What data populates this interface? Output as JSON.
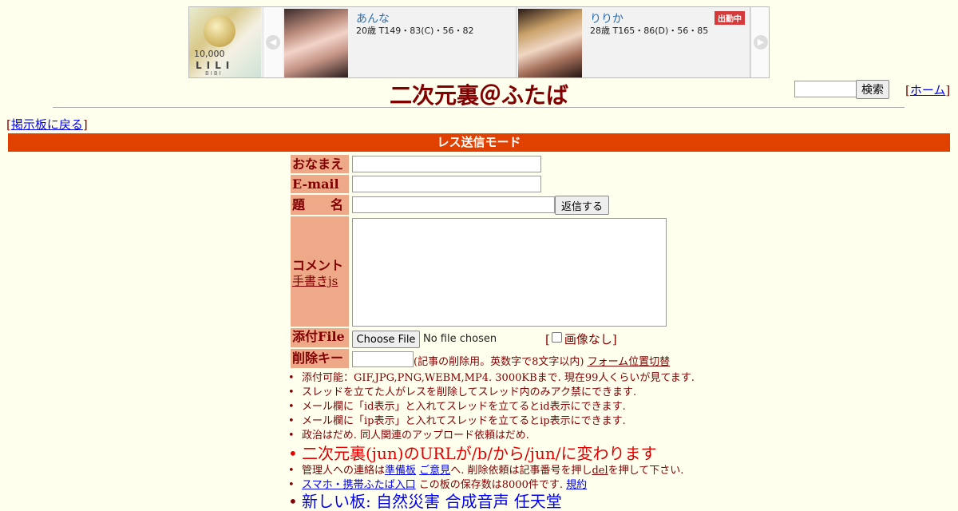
{
  "ad": {
    "logo_price": "10,000",
    "logo_brand": "LILI",
    "logo_brand_sub": "BIBI",
    "prev_glyph": "◀",
    "next_glyph": "▶",
    "cards": [
      {
        "name": "あんな",
        "stats": "20歳 T149・83(C)・56・82",
        "badge": ""
      },
      {
        "name": "りりか",
        "stats": "28歳 T165・86(D)・56・85",
        "badge": "出勤中"
      }
    ]
  },
  "header": {
    "title": "二次元裏＠ふたば",
    "search_button": "検索",
    "home_link": "ホーム",
    "back_link": "掲示板に戻る"
  },
  "mode_bar": "レス送信モード",
  "form": {
    "name_label": "おなまえ",
    "email_label": "E-mail",
    "subject_label_1": "題",
    "subject_label_2": "名",
    "reply_button": "返信する",
    "comment_label": "コメント",
    "handwriting_link": "手書きjs",
    "file_label": "添付File",
    "choose_file_button": "Choose File",
    "file_status": "No file chosen",
    "no_image_label": "画像なし",
    "delkey_label": "削除キー",
    "delkey_note": "(記事の削除用。英数字で8文字以内)",
    "form_toggle_link": "フォーム位置切替"
  },
  "notes": {
    "n1": "添付可能：GIF,JPG,PNG,WEBM,MP4. 3000KBまで. 現在99人くらいが見てます.",
    "n2": "スレッドを立てた人がレスを削除してスレッド内のみアク禁にできます.",
    "n3": "メール欄に「id表示」と入れてスレッドを立てるとid表示にできます.",
    "n4": "メール欄に「ip表示」と入れてスレッドを立てるとip表示にできます.",
    "n5": "政治はだめ. 同人関連のアップロード依頼はだめ.",
    "n6": "二次元裏(jun)のURLが/b/から/jun/に変わります",
    "n7_pre": "管理人への連絡は",
    "n7_link1": "準備板",
    "n7_link2": "ご意見",
    "n7_mid": "へ. 削除依頼は記事番号を押し",
    "n7_del": "del",
    "n7_post": "を押して下さい.",
    "n8_link": "スマホ・携帯ふたば入口",
    "n8_mid": " この板の保存数は8000件です.",
    "n8_rules": "規約",
    "n9": "新しい板: 自然災害 合成音声 任天堂"
  }
}
